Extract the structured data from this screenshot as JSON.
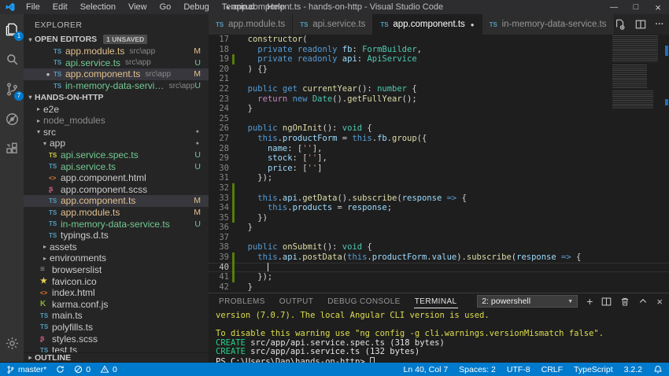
{
  "icons": {
    "dot": "●",
    "twisty_open": "▾",
    "twisty_closed": "▸",
    "minimize": "—",
    "restore": "□",
    "close": "×",
    "more": "···",
    "caret_up": "^",
    "plus": "+",
    "dropdown_arrow": "▼"
  },
  "titlebar": {
    "menus": [
      "File",
      "Edit",
      "Selection",
      "View",
      "Go",
      "Debug",
      "Terminal",
      "Help"
    ],
    "dirty_dot": "●",
    "title": "app.component.ts - hands-on-http - Visual Studio Code"
  },
  "activity_bar": {
    "explorer_badge": "1",
    "scm_badge": "7"
  },
  "sidebar": {
    "title": "EXPLORER",
    "open_editors": {
      "label": "OPEN EDITORS",
      "badge": "1 UNSAVED",
      "items": [
        {
          "name": "app.module.ts",
          "path": "src\\app",
          "icon_label": "TS",
          "icon": "ts",
          "git": "modified",
          "status": "M",
          "dirty": false,
          "selected": false
        },
        {
          "name": "api.service.ts",
          "path": "src\\app",
          "icon_label": "TS",
          "icon": "ts",
          "git": "untracked",
          "status": "U",
          "dirty": false,
          "selected": false
        },
        {
          "name": "app.component.ts",
          "path": "src\\app",
          "icon_label": "TS",
          "icon": "ts",
          "git": "modified",
          "status": "M",
          "dirty": true,
          "selected": true
        },
        {
          "name": "in-memory-data-service.ts",
          "path": "src\\app",
          "icon_label": "TS",
          "icon": "ts",
          "git": "untracked",
          "status": "U",
          "dirty": false,
          "selected": false
        }
      ]
    },
    "tree": {
      "root": "HANDS-ON-HTTP",
      "items": [
        {
          "label": "e2e",
          "indent": 1,
          "folder": true,
          "expanded": false
        },
        {
          "label": "node_modules",
          "indent": 1,
          "folder": true,
          "expanded": false,
          "dim": true
        },
        {
          "label": "src",
          "indent": 1,
          "folder": true,
          "expanded": true,
          "right_dot": true
        },
        {
          "label": "app",
          "indent": 2,
          "folder": true,
          "expanded": true,
          "right_dot": true
        },
        {
          "label": "api.service.spec.ts",
          "indent": 3,
          "icon": "ts-spec",
          "icon_label": "TS",
          "git": "untracked",
          "status": "U"
        },
        {
          "label": "api.service.ts",
          "indent": 3,
          "icon": "ts",
          "icon_label": "TS",
          "git": "untracked",
          "status": "U"
        },
        {
          "label": "app.component.html",
          "indent": 3,
          "icon": "html",
          "icon_label": "<>"
        },
        {
          "label": "app.component.scss",
          "indent": 3,
          "icon": "scss",
          "icon_label": "ʂ"
        },
        {
          "label": "app.component.ts",
          "indent": 3,
          "icon": "ts",
          "icon_label": "TS",
          "git": "modified",
          "status": "M",
          "selected": true
        },
        {
          "label": "app.module.ts",
          "indent": 3,
          "icon": "ts",
          "icon_label": "TS",
          "git": "modified",
          "status": "M"
        },
        {
          "label": "in-memory-data-service.ts",
          "indent": 3,
          "icon": "ts",
          "icon_label": "TS",
          "git": "untracked",
          "status": "U"
        },
        {
          "label": "typings.d.ts",
          "indent": 3,
          "icon": "ts",
          "icon_label": "TS"
        },
        {
          "label": "assets",
          "indent": 2,
          "folder": true,
          "expanded": false
        },
        {
          "label": "environments",
          "indent": 2,
          "folder": true,
          "expanded": false
        },
        {
          "label": "browserslist",
          "indent": 2,
          "icon": "list",
          "icon_label": "≡"
        },
        {
          "label": "favicon.ico",
          "indent": 2,
          "icon": "image",
          "icon_label": "★"
        },
        {
          "label": "index.html",
          "indent": 2,
          "icon": "html",
          "icon_label": "<>"
        },
        {
          "label": "karma.conf.js",
          "indent": 2,
          "icon": "karma",
          "icon_label": "K"
        },
        {
          "label": "main.ts",
          "indent": 2,
          "icon": "ts",
          "icon_label": "TS"
        },
        {
          "label": "polyfills.ts",
          "indent": 2,
          "icon": "ts",
          "icon_label": "TS"
        },
        {
          "label": "styles.scss",
          "indent": 2,
          "icon": "scss",
          "icon_label": "ʂ"
        },
        {
          "label": "test.ts",
          "indent": 2,
          "icon": "ts",
          "icon_label": "TS"
        }
      ]
    },
    "outline_label": "OUTLINE"
  },
  "tabs": {
    "items": [
      {
        "label": "app.module.ts",
        "icon_label": "TS",
        "active": false,
        "dirty": false
      },
      {
        "label": "api.service.ts",
        "icon_label": "TS",
        "active": false,
        "dirty": false
      },
      {
        "label": "app.component.ts",
        "icon_label": "TS",
        "active": true,
        "dirty": true
      },
      {
        "label": "in-memory-data-service.ts",
        "icon_label": "TS",
        "active": false,
        "dirty": false
      }
    ]
  },
  "editor": {
    "cursor": {
      "line": 40,
      "col": 7
    },
    "lines": [
      {
        "num": 17,
        "tokens": [
          {
            "t": "  ",
            "c": "pn"
          },
          {
            "t": "constructor",
            "c": "fn"
          },
          {
            "t": "(",
            "c": "pn"
          }
        ]
      },
      {
        "num": 18,
        "tokens": [
          {
            "t": "    ",
            "c": "pn"
          },
          {
            "t": "private",
            "c": "kw"
          },
          {
            "t": " ",
            "c": "pn"
          },
          {
            "t": "readonly",
            "c": "kw"
          },
          {
            "t": " ",
            "c": "pn"
          },
          {
            "t": "fb",
            "c": "prop"
          },
          {
            "t": ": ",
            "c": "pn"
          },
          {
            "t": "FormBuilder",
            "c": "type"
          },
          {
            "t": ",",
            "c": "pn"
          }
        ]
      },
      {
        "num": 19,
        "changed": true,
        "tokens": [
          {
            "t": "    ",
            "c": "pn"
          },
          {
            "t": "private",
            "c": "kw"
          },
          {
            "t": " ",
            "c": "pn"
          },
          {
            "t": "readonly",
            "c": "kw"
          },
          {
            "t": " ",
            "c": "pn"
          },
          {
            "t": "api",
            "c": "prop"
          },
          {
            "t": ": ",
            "c": "pn"
          },
          {
            "t": "ApiService",
            "c": "type"
          }
        ]
      },
      {
        "num": 20,
        "tokens": [
          {
            "t": "  ) {}",
            "c": "pn"
          }
        ]
      },
      {
        "num": 21,
        "tokens": []
      },
      {
        "num": 22,
        "tokens": [
          {
            "t": "  ",
            "c": "pn"
          },
          {
            "t": "public",
            "c": "kw"
          },
          {
            "t": " ",
            "c": "pn"
          },
          {
            "t": "get",
            "c": "kw"
          },
          {
            "t": " ",
            "c": "pn"
          },
          {
            "t": "currentYear",
            "c": "fn"
          },
          {
            "t": "(): ",
            "c": "pn"
          },
          {
            "t": "number",
            "c": "type"
          },
          {
            "t": " {",
            "c": "pn"
          }
        ]
      },
      {
        "num": 23,
        "tokens": [
          {
            "t": "    ",
            "c": "pn"
          },
          {
            "t": "return",
            "c": "ctrl"
          },
          {
            "t": " ",
            "c": "pn"
          },
          {
            "t": "new",
            "c": "kw"
          },
          {
            "t": " ",
            "c": "pn"
          },
          {
            "t": "Date",
            "c": "type"
          },
          {
            "t": "().",
            "c": "pn"
          },
          {
            "t": "getFullYear",
            "c": "fn"
          },
          {
            "t": "();",
            "c": "pn"
          }
        ]
      },
      {
        "num": 24,
        "tokens": [
          {
            "t": "  }",
            "c": "pn"
          }
        ]
      },
      {
        "num": 25,
        "tokens": []
      },
      {
        "num": 26,
        "tokens": [
          {
            "t": "  ",
            "c": "pn"
          },
          {
            "t": "public",
            "c": "kw"
          },
          {
            "t": " ",
            "c": "pn"
          },
          {
            "t": "ngOnInit",
            "c": "fn"
          },
          {
            "t": "(): ",
            "c": "pn"
          },
          {
            "t": "void",
            "c": "type"
          },
          {
            "t": " {",
            "c": "pn"
          }
        ]
      },
      {
        "num": 27,
        "tokens": [
          {
            "t": "    ",
            "c": "pn"
          },
          {
            "t": "this",
            "c": "kw"
          },
          {
            "t": ".",
            "c": "pn"
          },
          {
            "t": "productForm",
            "c": "prop"
          },
          {
            "t": " = ",
            "c": "pn"
          },
          {
            "t": "this",
            "c": "kw"
          },
          {
            "t": ".",
            "c": "pn"
          },
          {
            "t": "fb",
            "c": "prop"
          },
          {
            "t": ".",
            "c": "pn"
          },
          {
            "t": "group",
            "c": "fn"
          },
          {
            "t": "({",
            "c": "pn"
          }
        ]
      },
      {
        "num": 28,
        "tokens": [
          {
            "t": "      ",
            "c": "pn"
          },
          {
            "t": "name",
            "c": "prop"
          },
          {
            "t": ": [",
            "c": "pn"
          },
          {
            "t": "''",
            "c": "str"
          },
          {
            "t": "],",
            "c": "pn"
          }
        ]
      },
      {
        "num": 29,
        "tokens": [
          {
            "t": "      ",
            "c": "pn"
          },
          {
            "t": "stock",
            "c": "prop"
          },
          {
            "t": ": [",
            "c": "pn"
          },
          {
            "t": "''",
            "c": "str"
          },
          {
            "t": "],",
            "c": "pn"
          }
        ]
      },
      {
        "num": 30,
        "tokens": [
          {
            "t": "      ",
            "c": "pn"
          },
          {
            "t": "price",
            "c": "prop"
          },
          {
            "t": ": [",
            "c": "pn"
          },
          {
            "t": "''",
            "c": "str"
          },
          {
            "t": "]",
            "c": "pn"
          }
        ]
      },
      {
        "num": 31,
        "tokens": [
          {
            "t": "    });",
            "c": "pn"
          }
        ]
      },
      {
        "num": 32,
        "changed": true,
        "tokens": []
      },
      {
        "num": 33,
        "changed": true,
        "tokens": [
          {
            "t": "    ",
            "c": "pn"
          },
          {
            "t": "this",
            "c": "kw"
          },
          {
            "t": ".",
            "c": "pn"
          },
          {
            "t": "api",
            "c": "prop"
          },
          {
            "t": ".",
            "c": "pn"
          },
          {
            "t": "getData",
            "c": "fn"
          },
          {
            "t": "().",
            "c": "pn"
          },
          {
            "t": "subscribe",
            "c": "fn"
          },
          {
            "t": "(",
            "c": "pn"
          },
          {
            "t": "response",
            "c": "prop"
          },
          {
            "t": " ",
            "c": "pn"
          },
          {
            "t": "=>",
            "c": "kw"
          },
          {
            "t": " {",
            "c": "pn"
          }
        ]
      },
      {
        "num": 34,
        "changed": true,
        "tokens": [
          {
            "t": "      ",
            "c": "pn"
          },
          {
            "t": "this",
            "c": "kw"
          },
          {
            "t": ".",
            "c": "pn"
          },
          {
            "t": "products",
            "c": "prop"
          },
          {
            "t": " = ",
            "c": "pn"
          },
          {
            "t": "response",
            "c": "prop"
          },
          {
            "t": ";",
            "c": "pn"
          }
        ]
      },
      {
        "num": 35,
        "changed": true,
        "tokens": [
          {
            "t": "    })",
            "c": "pn"
          }
        ]
      },
      {
        "num": 36,
        "tokens": [
          {
            "t": "  }",
            "c": "pn"
          }
        ]
      },
      {
        "num": 37,
        "tokens": []
      },
      {
        "num": 38,
        "tokens": [
          {
            "t": "  ",
            "c": "pn"
          },
          {
            "t": "public",
            "c": "kw"
          },
          {
            "t": " ",
            "c": "pn"
          },
          {
            "t": "onSubmit",
            "c": "fn"
          },
          {
            "t": "(): ",
            "c": "pn"
          },
          {
            "t": "void",
            "c": "type"
          },
          {
            "t": " {",
            "c": "pn"
          }
        ]
      },
      {
        "num": 39,
        "changed": true,
        "tokens": [
          {
            "t": "    ",
            "c": "pn"
          },
          {
            "t": "this",
            "c": "kw"
          },
          {
            "t": ".",
            "c": "pn"
          },
          {
            "t": "api",
            "c": "prop"
          },
          {
            "t": ".",
            "c": "pn"
          },
          {
            "t": "postData",
            "c": "fn"
          },
          {
            "t": "(",
            "c": "pn"
          },
          {
            "t": "this",
            "c": "kw"
          },
          {
            "t": ".",
            "c": "pn"
          },
          {
            "t": "productForm",
            "c": "prop"
          },
          {
            "t": ".",
            "c": "pn"
          },
          {
            "t": "value",
            "c": "prop"
          },
          {
            "t": ").",
            "c": "pn"
          },
          {
            "t": "subscribe",
            "c": "fn"
          },
          {
            "t": "(",
            "c": "pn"
          },
          {
            "t": "response",
            "c": "prop"
          },
          {
            "t": " ",
            "c": "pn"
          },
          {
            "t": "=>",
            "c": "kw"
          },
          {
            "t": " {",
            "c": "pn"
          }
        ]
      },
      {
        "num": 40,
        "changed": true,
        "active": true,
        "tokens": [
          {
            "t": "      ",
            "c": "pn"
          }
        ]
      },
      {
        "num": 41,
        "changed": true,
        "tokens": [
          {
            "t": "    });",
            "c": "pn"
          }
        ]
      },
      {
        "num": 42,
        "tokens": [
          {
            "t": "  }",
            "c": "pn"
          }
        ]
      }
    ]
  },
  "panel": {
    "tabs": [
      {
        "label": "PROBLEMS",
        "active": false
      },
      {
        "label": "OUTPUT",
        "active": false
      },
      {
        "label": "DEBUG CONSOLE",
        "active": false
      },
      {
        "label": "TERMINAL",
        "active": true
      }
    ],
    "shell_select": "2: powershell",
    "lines": [
      [
        {
          "t": "version (7.0.7). The local Angular CLI version is used.",
          "c": "y"
        }
      ],
      [],
      [
        {
          "t": "To disable this warning use \"ng config -g cli.warnings.versionMismatch false\".",
          "c": "y"
        }
      ],
      [
        {
          "t": "CREATE ",
          "c": "g"
        },
        {
          "t": "src/app/api.service.spec.ts (318 bytes)",
          "c": "w"
        }
      ],
      [
        {
          "t": "CREATE ",
          "c": "g"
        },
        {
          "t": "src/app/api.service.ts (132 bytes)",
          "c": "w"
        }
      ],
      [
        {
          "t": "PS C:\\Users\\Dan\\hands-on-http> ",
          "c": "w"
        },
        {
          "t": "",
          "c": "cursor"
        }
      ]
    ]
  },
  "statusbar": {
    "branch": "master*",
    "errors": "0",
    "warnings": "0",
    "right_items": [
      "Ln 40, Col 7",
      "Spaces: 2",
      "UTF-8",
      "CRLF",
      "TypeScript",
      "3.2.2"
    ]
  }
}
